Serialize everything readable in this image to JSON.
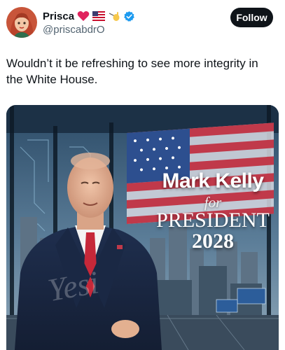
{
  "author": {
    "display_name": "Prisca",
    "handle": "@priscabdrO",
    "badges": [
      "heart-emoji",
      "us-flag-emoji",
      "hand-emoji",
      "verified-badge"
    ]
  },
  "actions": {
    "follow_label": "Follow"
  },
  "tweet": {
    "text": "Wouldn’t it be refreshing to see more integrity in the White House."
  },
  "image": {
    "line1": "Mark Kelly",
    "line2": "for",
    "line3": "PRESIDENT",
    "line4": "2028"
  },
  "colors": {
    "follow_bg": "#0f1419",
    "verified": "#1d9bf0",
    "handle": "#536471"
  }
}
